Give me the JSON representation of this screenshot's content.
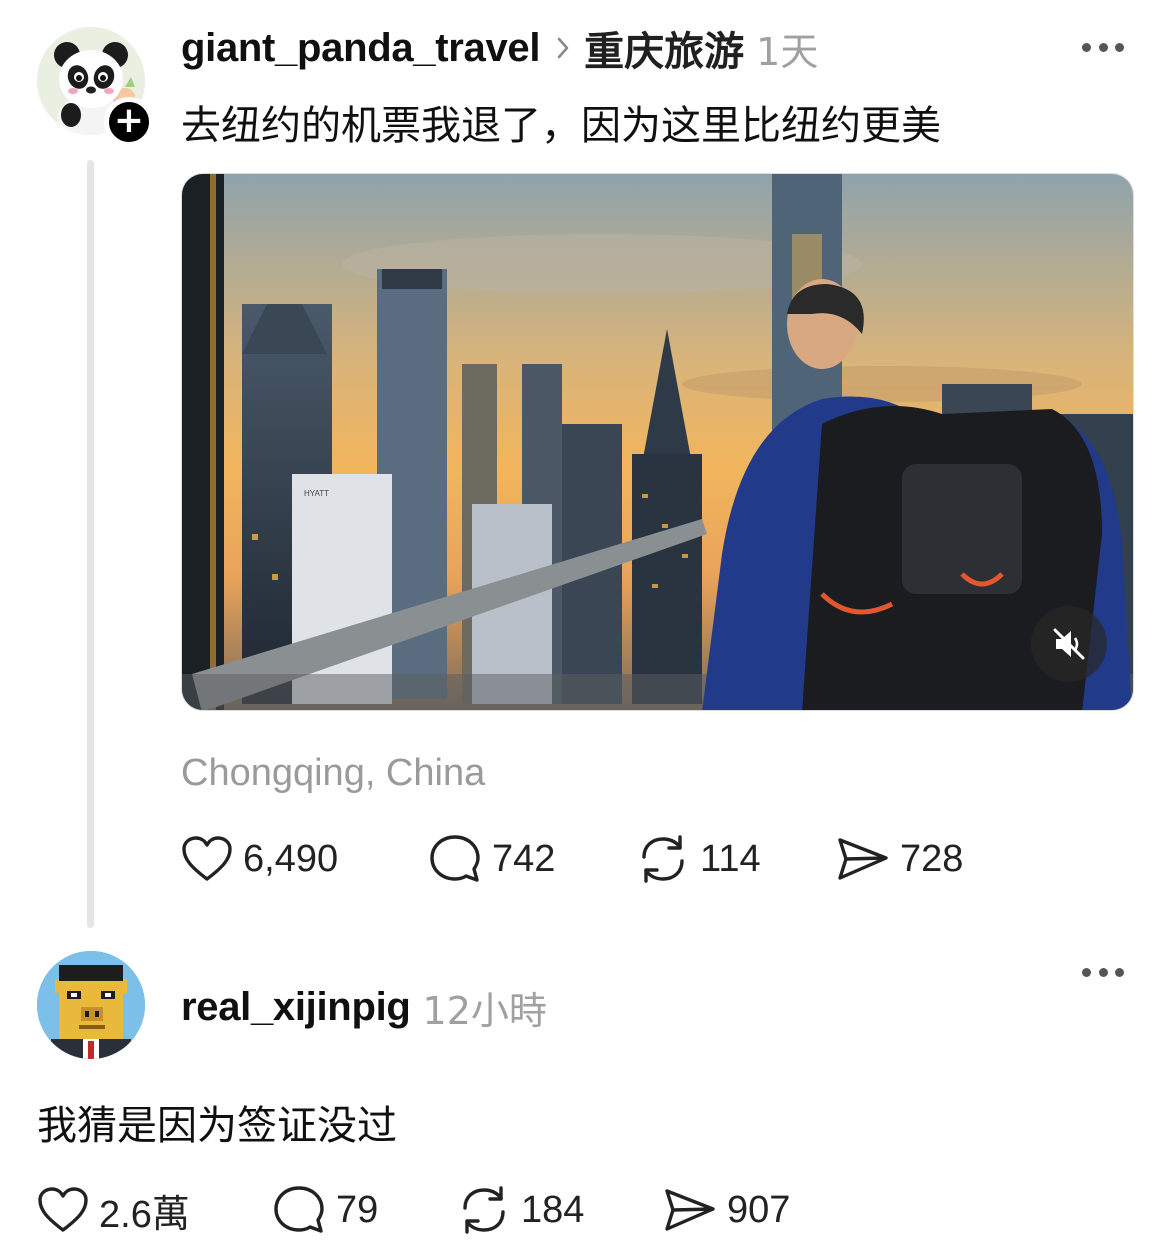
{
  "post": {
    "username": "giant_panda_travel",
    "topic": "重庆旅游",
    "time": "1天",
    "text": "去纽约的机票我退了，因为这里比纽约更美",
    "location": "Chongqing, China",
    "avatar_icon": "panda-avatar",
    "follow_icon": "plus-icon",
    "video_sign_text": "HYATT",
    "stats": {
      "likes": "6,490",
      "comments": "742",
      "reposts": "114",
      "shares": "728"
    }
  },
  "reply": {
    "username": "real_xijinpig",
    "time": "12小時",
    "text": "我猜是因为签证没过",
    "avatar_icon": "pixel-pig-avatar",
    "stats": {
      "likes": "2.6萬",
      "comments": "79",
      "reposts": "184",
      "shares": "907"
    }
  },
  "icons": {
    "like": "heart-icon",
    "comment": "comment-bubble-icon",
    "repost": "repost-icon",
    "share": "send-icon",
    "more": "more-dots-icon",
    "mute": "speaker-muted-icon",
    "chevron": "chevron-right-icon"
  },
  "colors": {
    "text_primary": "#101010",
    "text_secondary": "#a0a0a0",
    "thread_line": "#e5e5e5"
  }
}
